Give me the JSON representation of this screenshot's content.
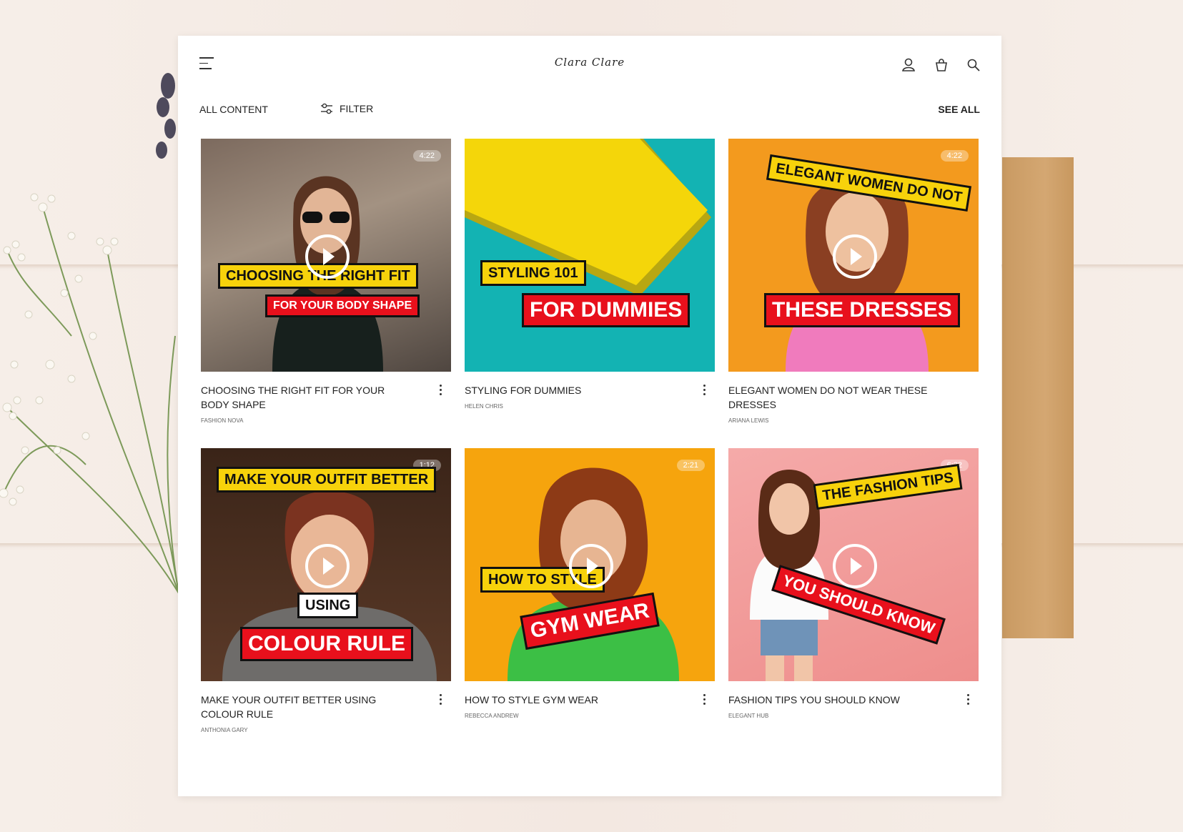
{
  "header": {
    "brand": "Clara Clare",
    "icons": [
      "menu-icon",
      "user-icon",
      "bag-icon",
      "search-icon"
    ]
  },
  "toolbar": {
    "all_content": "ALL CONTENT",
    "filter": "FILTER",
    "see_all": "SEE ALL"
  },
  "videos": [
    {
      "title": "CHOOSING THE RIGHT FIT FOR YOUR BODY SHAPE",
      "author": "FASHION NOVA",
      "duration": "4:22",
      "overlay": [
        "CHOOSING THE RIGHT FIT",
        "FOR YOUR BODY SHAPE"
      ]
    },
    {
      "title": "STYLING FOR DUMMIES",
      "author": "HELEN CHRIS",
      "duration": "",
      "overlay": [
        "STYLING 101",
        "FOR DUMMIES"
      ]
    },
    {
      "title": "ELEGANT WOMEN DO NOT WEAR THESE DRESSES",
      "author": "ARIANA LEWIS",
      "duration": "4:22",
      "overlay": [
        "ELEGANT WOMEN DO NOT",
        "THESE DRESSES"
      ]
    },
    {
      "title": "MAKE YOUR OUTFIT BETTER USING COLOUR RULE",
      "author": "ANTHONIA GARY",
      "duration": "1:12",
      "overlay": [
        "MAKE YOUR OUTFIT BETTER",
        "USING",
        "COLOUR RULE"
      ]
    },
    {
      "title": "HOW TO STYLE GYM WEAR",
      "author": "REBECCA ANDREW",
      "duration": "2:21",
      "overlay": [
        "HOW TO STYLE",
        "GYM WEAR"
      ]
    },
    {
      "title": "FASHION TIPS YOU SHOULD KNOW",
      "author": "ELEGANT HUB",
      "duration": "6:32",
      "overlay": [
        "THE FASHION TIPS",
        "YOU SHOULD KNOW"
      ]
    }
  ],
  "colors": {
    "yellow_label": "#f7d20b",
    "red_label": "#e8101c",
    "card_bg": "#ffffff"
  }
}
